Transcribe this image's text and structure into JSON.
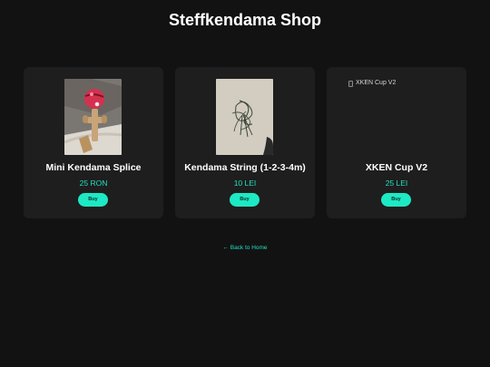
{
  "page": {
    "title": "Steffkendama Shop",
    "background_color": "#121212",
    "card_color": "#1e1e1e",
    "accent_color": "#1de9c4"
  },
  "products": [
    {
      "name": "Mini Kendama Splice",
      "price": "25 RON",
      "buy_label": "Buy",
      "image": "mini-kendama-photo"
    },
    {
      "name": "Kendama String (1-2-3-4m)",
      "price": "10 LEI",
      "buy_label": "Buy",
      "image": "kendama-string-photo"
    },
    {
      "name": "XKEN Cup V2",
      "price": "25 LEI",
      "buy_label": "Buy",
      "image_alt": "XKEN Cup V2",
      "image_icon": "broken-image-icon"
    }
  ],
  "footer": {
    "back_link": "← Back to Home"
  }
}
